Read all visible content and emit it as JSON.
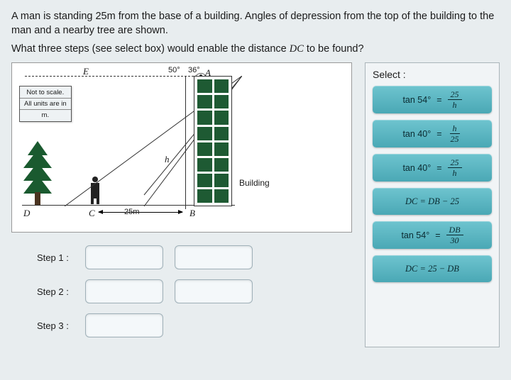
{
  "question": {
    "line1": "A man is standing 25m from the base of a building. Angles of depression from the top of the building to the man and a nearby tree are shown.",
    "line2_a": "What three steps (see select box) would enable the distance ",
    "line2_dc": "DC",
    "line2_b": " to be found?"
  },
  "diagram": {
    "note": {
      "l1": "Not to scale.",
      "l2": "All units are in",
      "l3": "m."
    },
    "points": {
      "E": "E",
      "A": "A",
      "D": "D",
      "C": "C",
      "B": "B"
    },
    "h_label": "h",
    "angle50": "50°",
    "angle36": "36°",
    "distance": "25m",
    "building_label": "Building"
  },
  "steps": {
    "s1": "Step 1 :",
    "s2": "Step 2 :",
    "s3": "Step 3 :"
  },
  "select": {
    "title": "Select :",
    "options": [
      {
        "lhs": "tan 54°",
        "frac": {
          "num": "25",
          "den": "h"
        }
      },
      {
        "lhs": "tan 40°",
        "frac": {
          "num": "h",
          "den": "25"
        }
      },
      {
        "lhs": "tan 40°",
        "frac": {
          "num": "25",
          "den": "h"
        }
      },
      {
        "plain_a": "DC",
        "plain_b": " = ",
        "plain_c": "DB",
        "plain_d": " − 25"
      },
      {
        "lhs": "tan 54°",
        "frac": {
          "num": "DB",
          "den": "30"
        }
      },
      {
        "plain_a": "DC",
        "plain_b": " = 25 − ",
        "plain_c": "DB",
        "plain_d": ""
      }
    ]
  }
}
